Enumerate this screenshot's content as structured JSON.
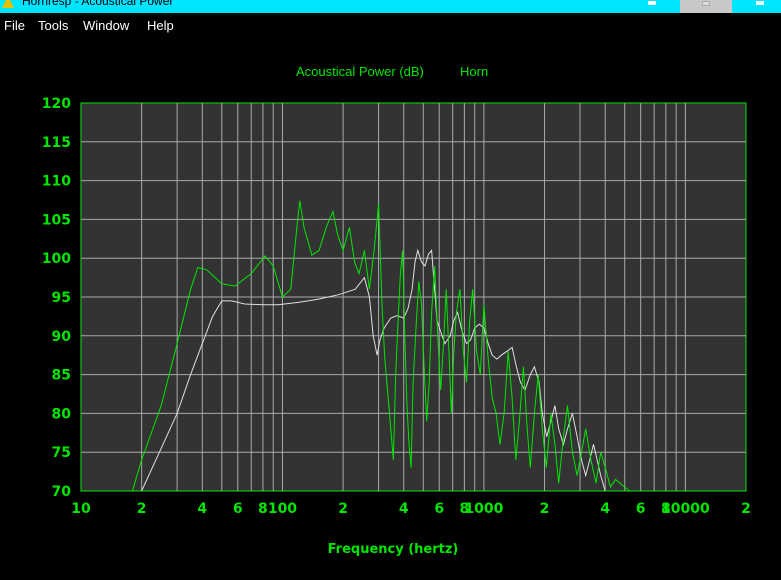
{
  "window": {
    "title": "Hornresp - Acoustical Power"
  },
  "menu": [
    "File",
    "Tools",
    "Window",
    "Help"
  ],
  "colors": {
    "background": "#000000",
    "plot_bg": "#333333",
    "grid": "#aaaaaa",
    "axis_text": "#00e600",
    "horn_curve": "#00e600",
    "reference_curve": "#e0e0e0",
    "titlebar": "#00e5ff"
  },
  "chart_data": {
    "type": "line",
    "title": "Acoustical Power (dB)",
    "series_label": "Horn",
    "xlabel": "Frequency (hertz)",
    "ylabel": "",
    "x_scale": "log",
    "xlim": [
      10,
      20000
    ],
    "ylim": [
      70,
      120
    ],
    "grid": true,
    "y_ticks": [
      120,
      115,
      110,
      105,
      100,
      95,
      90,
      85,
      80,
      75,
      70
    ],
    "x_tick_labels": [
      {
        "x": 10,
        "label": "10"
      },
      {
        "x": 20,
        "label": "2"
      },
      {
        "x": 40,
        "label": "4"
      },
      {
        "x": 60,
        "label": "6"
      },
      {
        "x": 80,
        "label": "8"
      },
      {
        "x": 100,
        "label": "100"
      },
      {
        "x": 200,
        "label": "2"
      },
      {
        "x": 400,
        "label": "4"
      },
      {
        "x": 600,
        "label": "6"
      },
      {
        "x": 800,
        "label": "8"
      },
      {
        "x": 1000,
        "label": "1000"
      },
      {
        "x": 2000,
        "label": "2"
      },
      {
        "x": 4000,
        "label": "4"
      },
      {
        "x": 6000,
        "label": "6"
      },
      {
        "x": 8000,
        "label": "8"
      },
      {
        "x": 10000,
        "label": "10000"
      },
      {
        "x": 20000,
        "label": "2"
      }
    ],
    "series": [
      {
        "name": "Horn",
        "color": "#00e600",
        "points": [
          [
            18,
            70
          ],
          [
            20,
            74
          ],
          [
            25,
            81
          ],
          [
            30,
            89
          ],
          [
            35,
            96
          ],
          [
            38,
            98.8
          ],
          [
            42,
            98.5
          ],
          [
            50,
            96.7
          ],
          [
            58,
            96.4
          ],
          [
            70,
            98
          ],
          [
            82,
            100.3
          ],
          [
            90,
            99
          ],
          [
            100,
            95
          ],
          [
            110,
            96
          ],
          [
            118,
            104
          ],
          [
            122,
            107.4
          ],
          [
            128,
            104
          ],
          [
            140,
            100.4
          ],
          [
            152,
            101
          ],
          [
            165,
            104
          ],
          [
            178,
            106
          ],
          [
            188,
            103
          ],
          [
            200,
            101
          ],
          [
            215,
            104
          ],
          [
            228,
            99.5
          ],
          [
            240,
            98
          ],
          [
            255,
            101
          ],
          [
            270,
            96
          ],
          [
            285,
            101
          ],
          [
            300,
            107
          ],
          [
            312,
            94
          ],
          [
            322,
            87
          ],
          [
            335,
            82
          ],
          [
            345,
            78
          ],
          [
            355,
            74
          ],
          [
            365,
            85
          ],
          [
            375,
            92
          ],
          [
            385,
            98
          ],
          [
            395,
            101
          ],
          [
            405,
            90
          ],
          [
            415,
            81
          ],
          [
            425,
            76
          ],
          [
            435,
            73
          ],
          [
            445,
            84
          ],
          [
            460,
            91
          ],
          [
            475,
            97
          ],
          [
            490,
            94
          ],
          [
            505,
            86
          ],
          [
            520,
            79
          ],
          [
            535,
            84
          ],
          [
            550,
            93
          ],
          [
            570,
            99
          ],
          [
            590,
            90
          ],
          [
            610,
            83
          ],
          [
            630,
            89
          ],
          [
            650,
            96
          ],
          [
            670,
            88
          ],
          [
            690,
            80
          ],
          [
            710,
            88
          ],
          [
            730,
            93
          ],
          [
            760,
            96
          ],
          [
            790,
            88
          ],
          [
            820,
            84
          ],
          [
            850,
            92
          ],
          [
            880,
            96
          ],
          [
            920,
            88
          ],
          [
            960,
            85
          ],
          [
            1000,
            94
          ],
          [
            1050,
            87
          ],
          [
            1100,
            82
          ],
          [
            1150,
            80
          ],
          [
            1200,
            76
          ],
          [
            1260,
            80
          ],
          [
            1320,
            88
          ],
          [
            1380,
            82
          ],
          [
            1440,
            74
          ],
          [
            1500,
            79
          ],
          [
            1570,
            86
          ],
          [
            1640,
            78
          ],
          [
            1700,
            73
          ],
          [
            1780,
            80
          ],
          [
            1860,
            85
          ],
          [
            1950,
            78
          ],
          [
            2040,
            73
          ],
          [
            2150,
            80
          ],
          [
            2250,
            76
          ],
          [
            2350,
            71
          ],
          [
            2480,
            77
          ],
          [
            2600,
            81
          ],
          [
            2750,
            75
          ],
          [
            2900,
            72
          ],
          [
            3050,
            75
          ],
          [
            3200,
            78
          ],
          [
            3400,
            74
          ],
          [
            3600,
            71
          ],
          [
            3800,
            75
          ],
          [
            4000,
            73
          ],
          [
            4250,
            70.5
          ],
          [
            4500,
            71.5
          ],
          [
            4750,
            71
          ],
          [
            5000,
            70.5
          ],
          [
            5300,
            70
          ]
        ]
      },
      {
        "name": "",
        "color": "#e0e0e0",
        "points": [
          [
            20,
            70
          ],
          [
            25,
            75.5
          ],
          [
            30,
            80
          ],
          [
            35,
            85
          ],
          [
            40,
            89
          ],
          [
            45,
            92.5
          ],
          [
            50,
            94.5
          ],
          [
            56,
            94.5
          ],
          [
            65,
            94.1
          ],
          [
            80,
            94
          ],
          [
            95,
            94
          ],
          [
            120,
            94.3
          ],
          [
            150,
            94.7
          ],
          [
            190,
            95.3
          ],
          [
            230,
            96
          ],
          [
            255,
            97.5
          ],
          [
            270,
            95
          ],
          [
            282,
            90
          ],
          [
            295,
            87.5
          ],
          [
            305,
            89.5
          ],
          [
            320,
            91
          ],
          [
            345,
            92.3
          ],
          [
            370,
            92.6
          ],
          [
            400,
            92.3
          ],
          [
            420,
            93.5
          ],
          [
            440,
            96
          ],
          [
            455,
            99.5
          ],
          [
            470,
            101
          ],
          [
            490,
            99.5
          ],
          [
            510,
            99
          ],
          [
            530,
            100.5
          ],
          [
            550,
            101
          ],
          [
            565,
            97
          ],
          [
            585,
            92
          ],
          [
            610,
            90.5
          ],
          [
            640,
            89
          ],
          [
            680,
            90
          ],
          [
            710,
            92
          ],
          [
            740,
            93
          ],
          [
            780,
            90.5
          ],
          [
            820,
            89
          ],
          [
            860,
            89.5
          ],
          [
            900,
            91
          ],
          [
            950,
            91.5
          ],
          [
            1000,
            91
          ],
          [
            1050,
            89
          ],
          [
            1100,
            87.5
          ],
          [
            1160,
            87
          ],
          [
            1220,
            87.5
          ],
          [
            1300,
            88
          ],
          [
            1380,
            88.5
          ],
          [
            1450,
            86
          ],
          [
            1520,
            84
          ],
          [
            1600,
            83
          ],
          [
            1700,
            85
          ],
          [
            1780,
            86
          ],
          [
            1880,
            84
          ],
          [
            1950,
            80
          ],
          [
            2050,
            77
          ],
          [
            2150,
            79
          ],
          [
            2250,
            81
          ],
          [
            2350,
            78
          ],
          [
            2480,
            76
          ],
          [
            2600,
            78
          ],
          [
            2750,
            80
          ],
          [
            2900,
            77
          ],
          [
            3050,
            74
          ],
          [
            3200,
            72
          ],
          [
            3350,
            74
          ],
          [
            3500,
            76
          ],
          [
            3650,
            74
          ],
          [
            3800,
            72
          ],
          [
            4000,
            70
          ]
        ]
      }
    ]
  }
}
